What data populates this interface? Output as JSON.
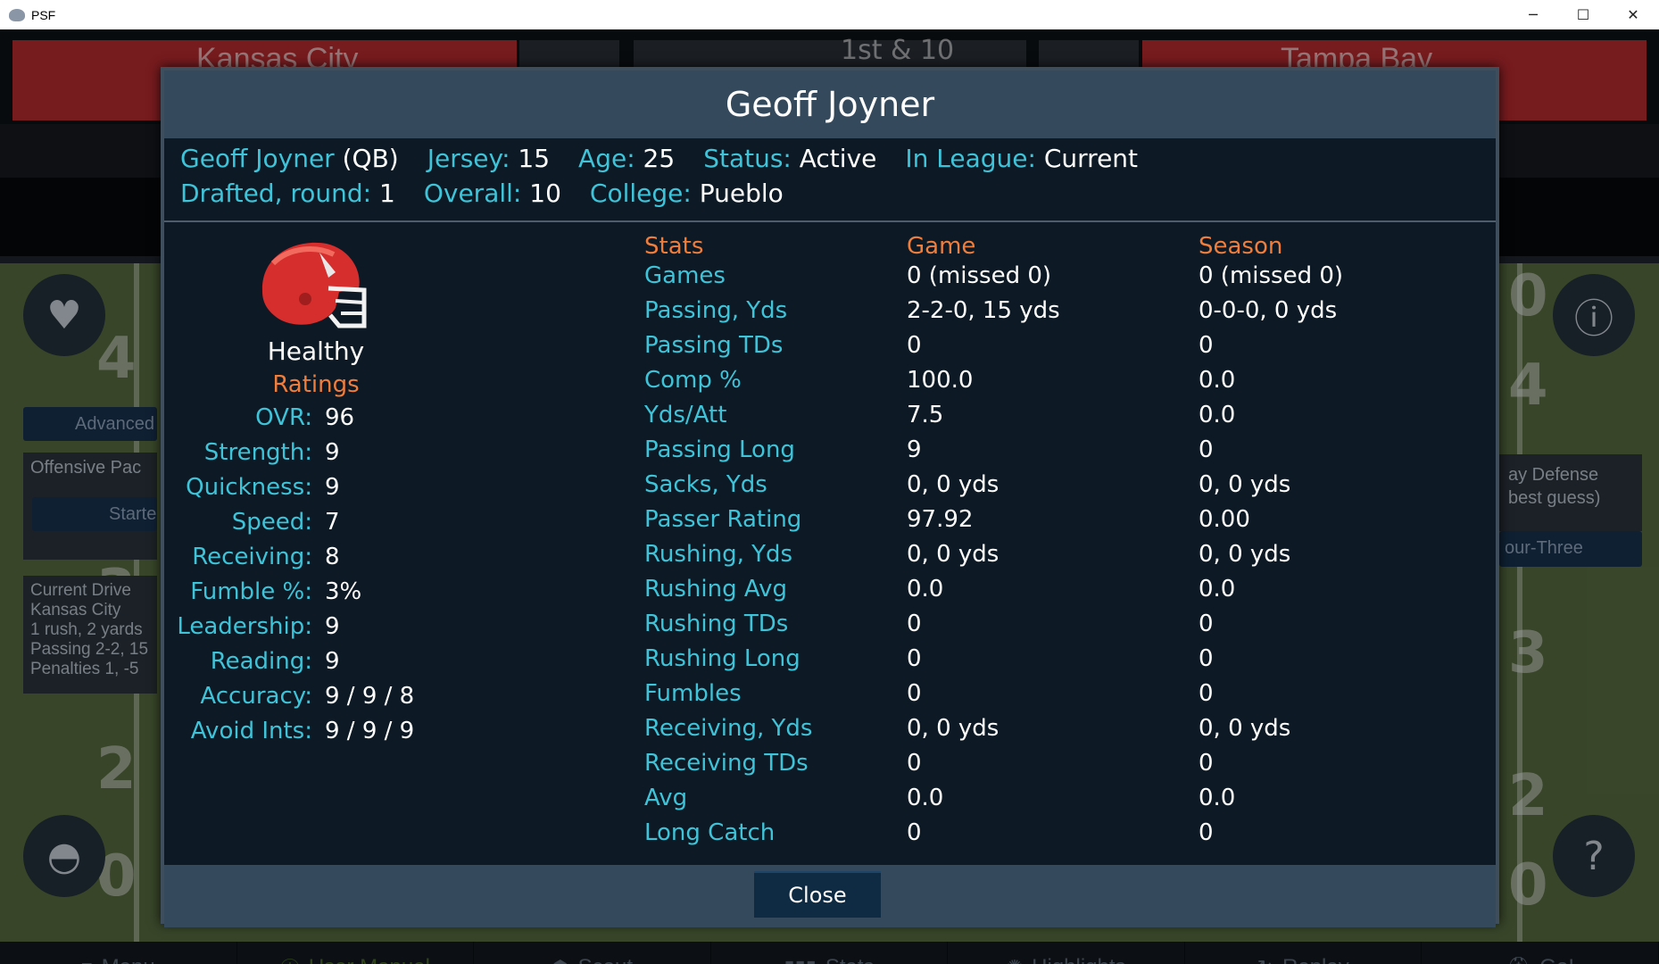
{
  "window": {
    "title": "PSF",
    "minimize_glyph": "─",
    "maximize_glyph": "☐",
    "close_glyph": "✕"
  },
  "background": {
    "team_left": "Kansas City",
    "team_right": "Tampa Bay",
    "down_distance": "1st & 10",
    "side_labels": {
      "advanced": "Advanced",
      "offensive_package": "Offensive Pac",
      "starter": "Starte",
      "current_drive": "Current Drive",
      "drive_team": "Kansas City",
      "drive_rush": "1 rush, 2 yards",
      "drive_passing": "Passing 2-2, 15",
      "drive_penalties": "Penalties 1, -5",
      "defense_line1": "ay Defense",
      "defense_line2": "best guess)",
      "defense_form": "our-Three"
    },
    "yard_numbers": [
      "4",
      "4",
      "3",
      "3",
      "2",
      "2",
      "0",
      "0",
      "0"
    ]
  },
  "nav": [
    {
      "icon": "≡",
      "label": "Menu"
    },
    {
      "icon": "ⓘ",
      "label": "User Manual"
    },
    {
      "icon": "☗",
      "label": "Scout"
    },
    {
      "icon": "▮▮▮",
      "label": "Stats"
    },
    {
      "icon": "✺",
      "label": "Highlights"
    },
    {
      "icon": "↻",
      "label": "Replay"
    },
    {
      "icon": "⛑",
      "label": "Go!"
    }
  ],
  "modal": {
    "title": "Geoff Joyner",
    "info": {
      "name": "Geoff Joyner",
      "position": "(QB)",
      "jersey_label": "Jersey:",
      "jersey": "15",
      "age_label": "Age:",
      "age": "25",
      "status_label": "Status:",
      "status": "Active",
      "league_label": "In League:",
      "league": "Current",
      "drafted_label": "Drafted, round:",
      "drafted": "1",
      "overall_label": "Overall:",
      "overall": "10",
      "college_label": "College:",
      "college": "Pueblo"
    },
    "health": "Healthy",
    "ratings_heading": "Ratings",
    "ratings": [
      {
        "label": "OVR:",
        "value": "96"
      },
      {
        "label": "Strength:",
        "value": "9"
      },
      {
        "label": "Quickness:",
        "value": "9"
      },
      {
        "label": "Speed:",
        "value": "7"
      },
      {
        "label": "Receiving:",
        "value": "8"
      },
      {
        "label": "Fumble %:",
        "value": "3%"
      },
      {
        "label": "Leadership:",
        "value": "9"
      },
      {
        "label": "Reading:",
        "value": "9"
      },
      {
        "label": "Accuracy:",
        "value": "9 / 9 / 8"
      },
      {
        "label": "Avoid Ints:",
        "value": "9 / 9 / 9"
      }
    ],
    "stats_headers": {
      "stats": "Stats",
      "game": "Game",
      "season": "Season"
    },
    "stats": [
      {
        "name": "Games",
        "game": "0 (missed 0)",
        "season": "0 (missed 0)"
      },
      {
        "name": "Passing, Yds",
        "game": "2-2-0, 15 yds",
        "season": "0-0-0, 0 yds"
      },
      {
        "name": "Passing TDs",
        "game": "0",
        "season": "0"
      },
      {
        "name": "Comp %",
        "game": "100.0",
        "season": "0.0"
      },
      {
        "name": "Yds/Att",
        "game": "7.5",
        "season": "0.0"
      },
      {
        "name": "Passing Long",
        "game": "9",
        "season": "0"
      },
      {
        "name": "Sacks, Yds",
        "game": "0, 0 yds",
        "season": "0, 0 yds"
      },
      {
        "name": "Passer Rating",
        "game": "97.92",
        "season": "0.00"
      },
      {
        "name": "Rushing, Yds",
        "game": "0, 0 yds",
        "season": "0, 0 yds"
      },
      {
        "name": "Rushing Avg",
        "game": "0.0",
        "season": "0.0"
      },
      {
        "name": "Rushing TDs",
        "game": "0",
        "season": "0"
      },
      {
        "name": "Rushing Long",
        "game": "0",
        "season": "0"
      },
      {
        "name": "Fumbles",
        "game": "0",
        "season": "0"
      },
      {
        "name": "Receiving, Yds",
        "game": "0, 0 yds",
        "season": "0, 0 yds"
      },
      {
        "name": "Receiving TDs",
        "game": "0",
        "season": "0"
      },
      {
        "name": "Avg",
        "game": "0.0",
        "season": "0.0"
      },
      {
        "name": "Long Catch",
        "game": "0",
        "season": "0"
      }
    ],
    "close_label": "Close"
  },
  "colors": {
    "accent_cyan": "#3fc3d8",
    "accent_orange": "#ef7d3c",
    "team_red": "#b52a2e",
    "modal_bg": "#0d1a25",
    "modal_header": "#35495c"
  }
}
